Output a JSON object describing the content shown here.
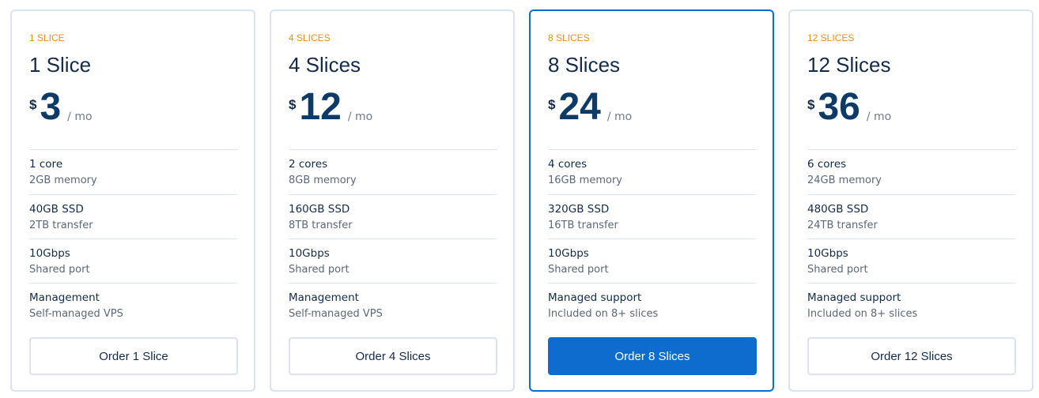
{
  "plans": [
    {
      "kicker": "1 SLICE",
      "title": "1 Slice",
      "currency": "$",
      "price": "3",
      "period": "/ mo",
      "specs": [
        {
          "main": "1 core",
          "sub": "2GB memory"
        },
        {
          "main": "40GB SSD",
          "sub": "2TB transfer"
        },
        {
          "main": "10Gbps",
          "sub": "Shared port"
        },
        {
          "main": "Management",
          "sub": "Self-managed VPS"
        }
      ],
      "button": "Order 1 Slice"
    },
    {
      "kicker": "4 SLICES",
      "title": "4 Slices",
      "currency": "$",
      "price": "12",
      "period": "/ mo",
      "specs": [
        {
          "main": "2 cores",
          "sub": "8GB memory"
        },
        {
          "main": "160GB SSD",
          "sub": "8TB transfer"
        },
        {
          "main": "10Gbps",
          "sub": "Shared port"
        },
        {
          "main": "Management",
          "sub": "Self-managed VPS"
        }
      ],
      "button": "Order 4 Slices"
    },
    {
      "kicker": "8 SLICES",
      "title": "8 Slices",
      "currency": "$",
      "price": "24",
      "period": "/ mo",
      "specs": [
        {
          "main": "4 cores",
          "sub": "16GB memory"
        },
        {
          "main": "320GB SSD",
          "sub": "16TB transfer"
        },
        {
          "main": "10Gbps",
          "sub": "Shared port"
        },
        {
          "main": "Managed support",
          "sub": "Included on 8+ slices"
        }
      ],
      "button": "Order 8 Slices"
    },
    {
      "kicker": "12 SLICES",
      "title": "12 Slices",
      "currency": "$",
      "price": "36",
      "period": "/ mo",
      "specs": [
        {
          "main": "6 cores",
          "sub": "24GB memory"
        },
        {
          "main": "480GB SSD",
          "sub": "24TB transfer"
        },
        {
          "main": "10Gbps",
          "sub": "Shared port"
        },
        {
          "main": "Managed support",
          "sub": "Included on 8+ slices"
        }
      ],
      "button": "Order 12 Slices"
    }
  ],
  "colors": {
    "accent": "#0e6ccf",
    "kicker": "#e0921b",
    "text": "#132b4b",
    "price": "#0d3a66",
    "border": "#dbe3ee"
  }
}
